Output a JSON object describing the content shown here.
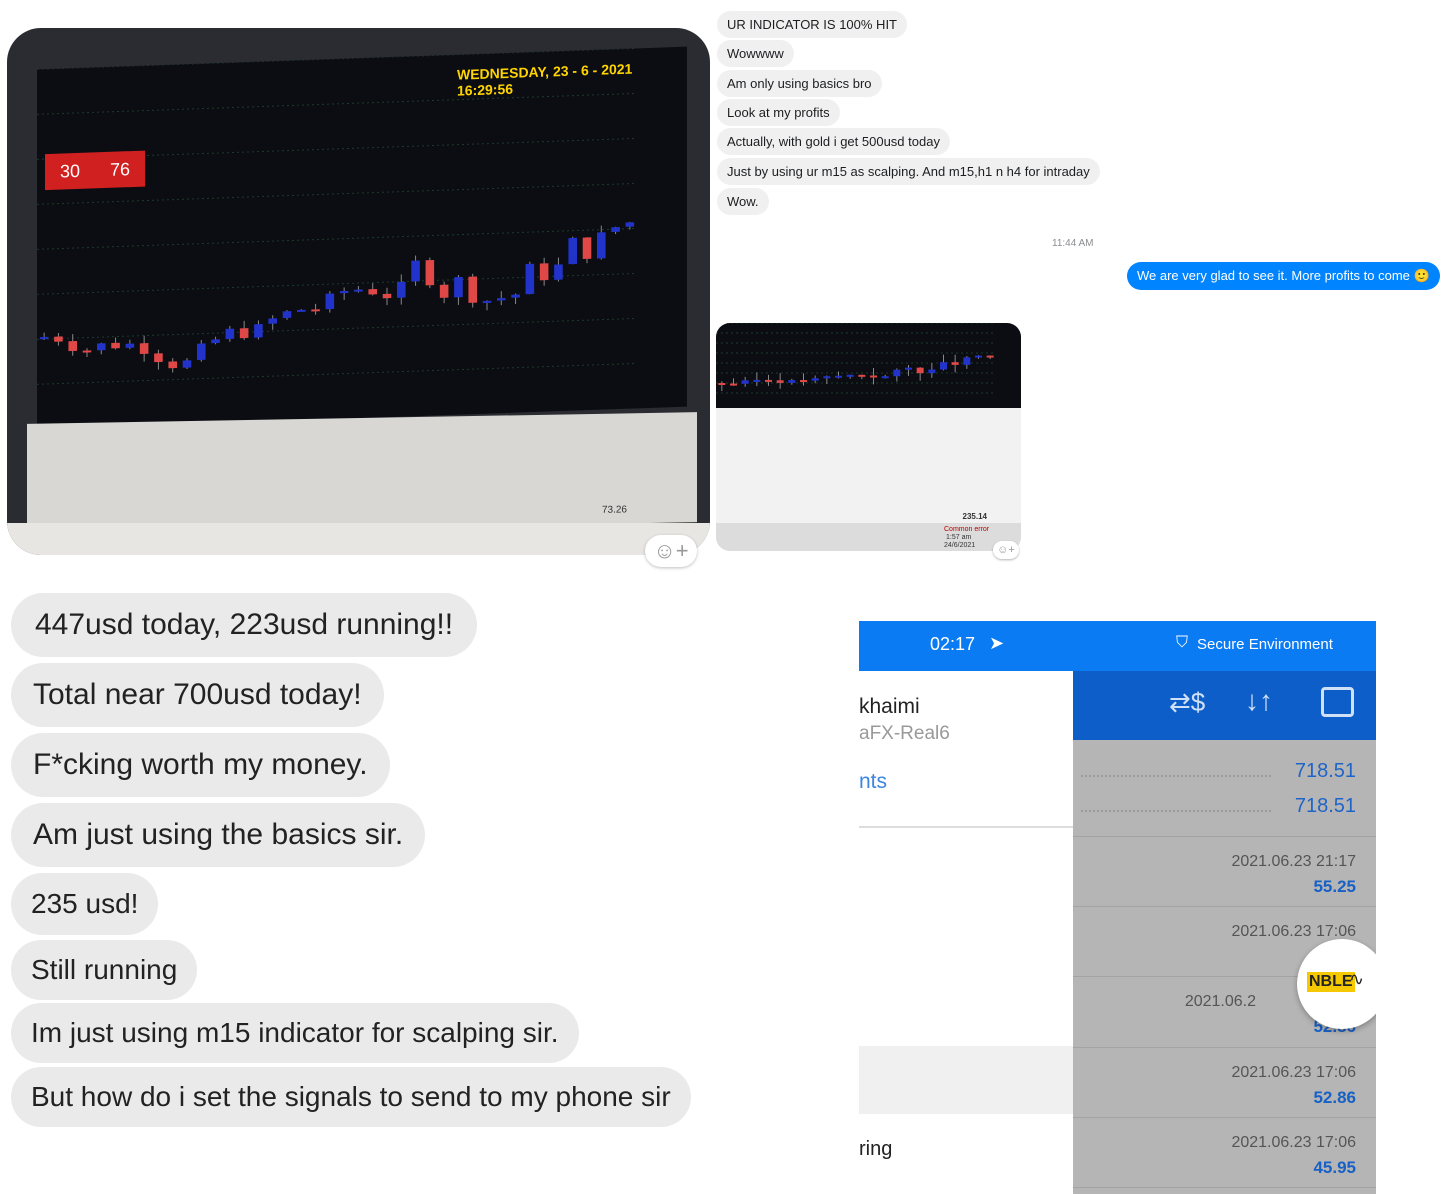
{
  "top_chat": {
    "received": [
      "UR INDICATOR IS 100% HIT",
      "Wowwww",
      "Am only using basics bro",
      "Look at my profits",
      "Actually, with gold i get 500usd today",
      "Just by using ur m15 as scalping. And m15,h1 n h4 for intraday",
      "Wow."
    ],
    "timestamp": "11:44 AM",
    "sent": "We are very glad to see it. More profits to come 🙂"
  },
  "photo_chart": {
    "date_overlay": "WEDNESDAY, 23 - 6 - 2021 16:29:56",
    "sell_value": "30",
    "buy_value": "76",
    "total_profit": "73.26"
  },
  "photo_small": {
    "total_profit": "235.14",
    "status": "Common error",
    "time": "1:57 am",
    "date": "24/6/2021"
  },
  "bottom_chat": [
    "447usd today, 223usd running!!",
    "Total near 700usd today!",
    "F*cking worth my money.",
    "Am just using the basics sir.",
    "235 usd!",
    "Still running",
    "Im just using m15 indicator for scalping sir.",
    "But how do i set the signals to send to my phone sir"
  ],
  "phone": {
    "time": "02:17",
    "secure_label": "Secure Environment",
    "account_name": "khaimi",
    "server": "aFX-Real6",
    "link": "nts",
    "menu_item": "ring",
    "balance": "718.51",
    "equity": "718.51",
    "deals": [
      {
        "date": "2021.06.23 21:17",
        "amount": "55.25"
      },
      {
        "date": "2021.06.23 17:06",
        "amount": ""
      },
      {
        "date": "2021.06.2",
        "amount": "52.86"
      },
      {
        "date": "2021.06.23 17:06",
        "amount": "52.86"
      },
      {
        "date": "2021.06.23 17:06",
        "amount": "45.95"
      }
    ],
    "badge": "NBLE",
    "colors": {
      "status_bar": "#0b7bf3",
      "header": "#0d5ec8",
      "amount": "#1760c6"
    }
  }
}
